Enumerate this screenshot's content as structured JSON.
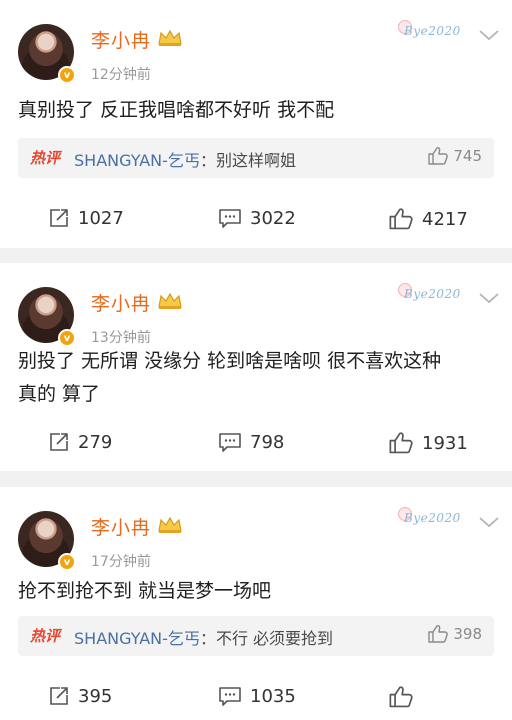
{
  "posts": [
    {
      "username": "李小冉",
      "time": "12分钟前",
      "verified_mark": "v",
      "watermark": "Bye2020",
      "content": "真别投了 反正我唱啥都不好听 我不配",
      "hot_comment": {
        "tag": "热评",
        "author": "SHANGYAN-乞丐",
        "separator": "：",
        "text": "别这样啊姐",
        "likes": "745"
      },
      "actions": {
        "repost": "1027",
        "comment": "3022",
        "like": "4217"
      }
    },
    {
      "username": "李小冉",
      "time": "13分钟前",
      "verified_mark": "v",
      "watermark": "Bye2020",
      "content": "别投了 无所谓 没缘分 轮到啥是啥呗 很不喜欢这种",
      "content_line2": "真的  算了",
      "actions": {
        "repost": "279",
        "comment": "798",
        "like": "1931"
      }
    },
    {
      "username": "李小冉",
      "time": "17分钟前",
      "verified_mark": "v",
      "watermark": "Bye2020",
      "content": "抢不到抢不到 就当是梦一场吧",
      "hot_comment": {
        "tag": "热评",
        "author": "SHANGYAN-乞丐",
        "separator": "：",
        "text": "不行 必须要抢到",
        "likes": "398"
      },
      "actions": {
        "repost": "395",
        "comment": "1035",
        "like": ""
      }
    }
  ],
  "icons": {
    "repost": "repost-icon",
    "comment": "comment-icon",
    "like": "thumbs-up-icon",
    "more": "chevron-down-icon",
    "crown": "crown-badge-icon"
  },
  "colors": {
    "username": "#e86a1c",
    "hot_tag": "#e8472f",
    "comment_author": "#4a6fa5",
    "meta": "#9a9a9a",
    "background": "#f1f1f1"
  }
}
